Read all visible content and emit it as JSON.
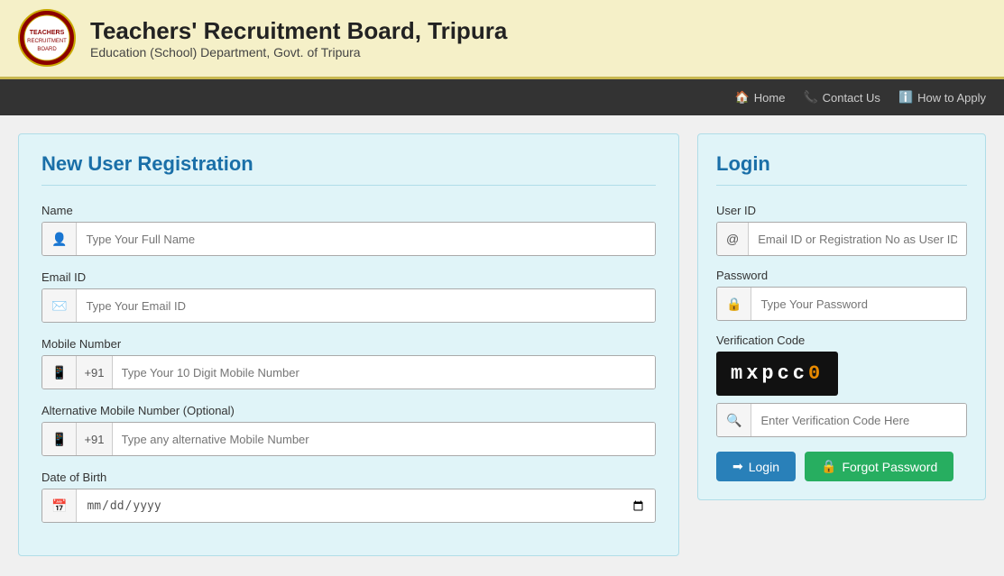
{
  "header": {
    "logo_alt": "Teachers Recruitment Board Logo",
    "title": "Teachers' Recruitment Board, Tripura",
    "subtitle": "Education (School) Department, Govt. of Tripura"
  },
  "navbar": {
    "home_label": "Home",
    "contact_label": "Contact Us",
    "howto_label": "How to Apply"
  },
  "registration": {
    "title": "New User Registration",
    "fields": {
      "name_label": "Name",
      "name_placeholder": "Type Your Full Name",
      "email_label": "Email ID",
      "email_placeholder": "Type Your Email ID",
      "mobile_label": "Mobile Number",
      "mobile_prefix": "+91",
      "mobile_placeholder": "Type Your 10 Digit Mobile Number",
      "alt_mobile_label": "Alternative Mobile Number (Optional)",
      "alt_mobile_prefix": "+91",
      "alt_mobile_placeholder": "Type any alternative Mobile Number",
      "dob_label": "Date of Birth",
      "dob_placeholder": "mm/dd/yyyy"
    }
  },
  "login": {
    "title": "Login",
    "userid_label": "User ID",
    "userid_placeholder": "Email ID or Registration No as User ID",
    "password_label": "Password",
    "password_placeholder": "Type Your Password",
    "verification_label": "Verification Code",
    "captcha_text": "mxpcc",
    "captcha_highlight": "0",
    "captcha_input_placeholder": "Enter Verification Code Here",
    "login_button": "Login",
    "forgot_button": "Forgot Password"
  }
}
